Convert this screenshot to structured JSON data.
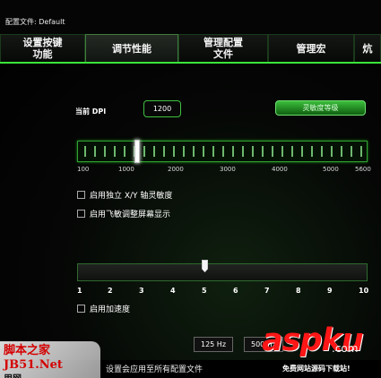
{
  "profile_label": "配置文件: Default",
  "tabs": [
    {
      "label": "设置按键\n功能"
    },
    {
      "label": "调节性能"
    },
    {
      "label": "管理配置\n文件"
    },
    {
      "label": "管理宏"
    },
    {
      "label": "炕"
    }
  ],
  "dpi": {
    "label": "当前 DPI",
    "value": "1200",
    "button": "灵敏度等级",
    "scale": [
      "100",
      "1000",
      "2000",
      "3000",
      "4000",
      "5000",
      "5600"
    ],
    "current": 1200
  },
  "checkboxes": [
    {
      "label": "启用独立 X/Y 轴灵敏度"
    },
    {
      "label": "启用飞敏调整屏幕显示"
    }
  ],
  "acceleration": {
    "scale": [
      "1",
      "2",
      "3",
      "4",
      "5",
      "6",
      "7",
      "8",
      "9",
      "10"
    ],
    "value": 5,
    "checkbox_label": "启用加速度"
  },
  "polling": {
    "option1": "125 Hz",
    "option2": "500 Hz"
  },
  "footer": {
    "note": "设置会应用至所有配置文件"
  },
  "watermarks": {
    "left_top": "脚本之家",
    "left_bottom": "JB51.Net",
    "left_small": "用网",
    "right_brand": "aspku",
    "right_domain": ".com",
    "right_slogan": "免费网站源码下载站!"
  },
  "colors": {
    "accent": "#3ae63a",
    "button": "#2d9d2d",
    "watermark_red": "#ff1616"
  }
}
